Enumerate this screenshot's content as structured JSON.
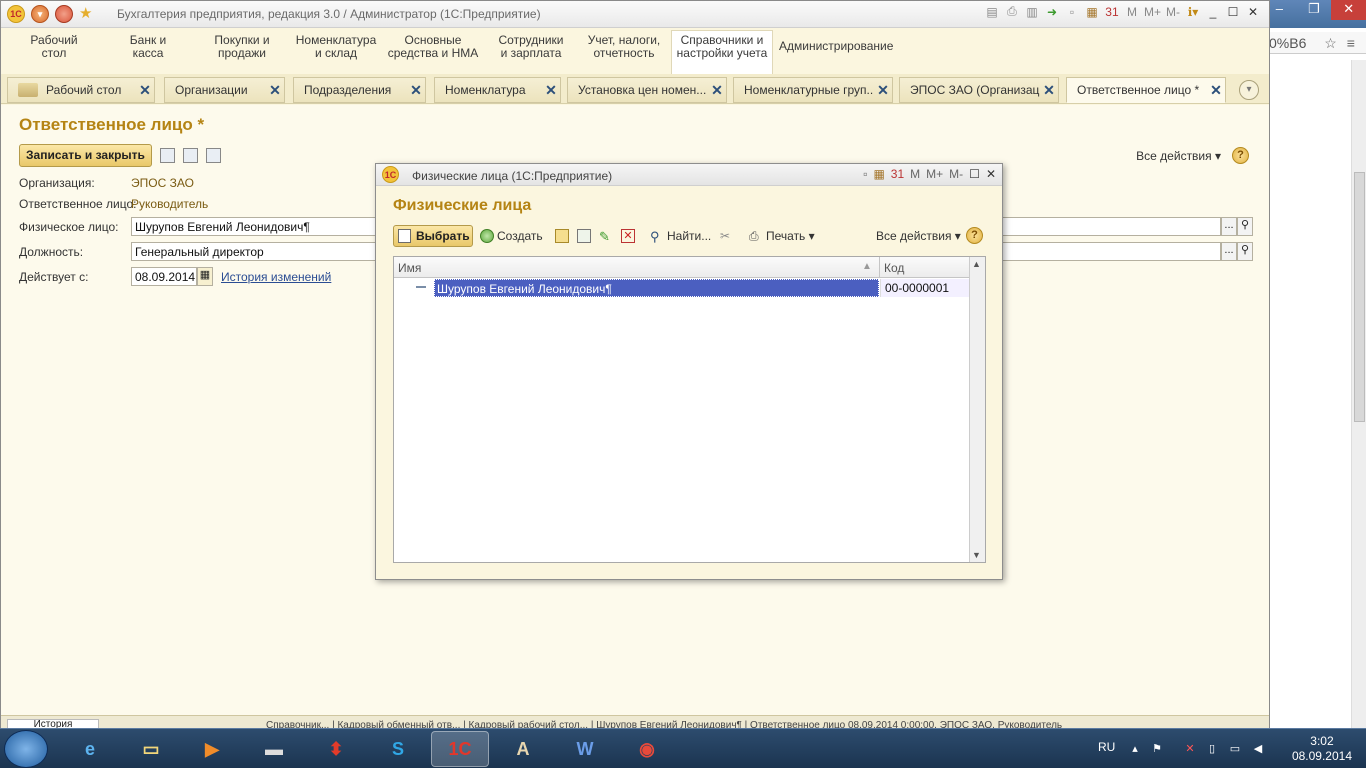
{
  "window": {
    "title": "Бухгалтерия предприятия, редакция 3.0 / Администратор  (1С:Предприятие)",
    "toolbar_labels": [
      "M",
      "M+",
      "M-"
    ]
  },
  "sections": [
    {
      "label1": "Рабочий",
      "label2": "стол"
    },
    {
      "label1": "Банк и",
      "label2": "касса"
    },
    {
      "label1": "Покупки и",
      "label2": "продажи"
    },
    {
      "label1": "Номенклатура",
      "label2": "и склад"
    },
    {
      "label1": "Основные",
      "label2": "средства и НМА"
    },
    {
      "label1": "Сотрудники",
      "label2": "и зарплата"
    },
    {
      "label1": "Учет, налоги,",
      "label2": "отчетность"
    },
    {
      "label1": "Справочники и",
      "label2": "настройки учета"
    },
    {
      "label1": "Администрирование",
      "label2": ""
    }
  ],
  "tabs": [
    {
      "label": "Рабочий стол"
    },
    {
      "label": "Организации"
    },
    {
      "label": "Подразделения"
    },
    {
      "label": "Номенклатура"
    },
    {
      "label": "Установка цен номен..."
    },
    {
      "label": "Номенклатурные груп..."
    },
    {
      "label": "ЭПОС ЗАО (Организац..."
    },
    {
      "label": "Ответственное лицо *"
    }
  ],
  "form": {
    "title": "Ответственное лицо *",
    "save_close": "Записать и закрыть",
    "all_actions": "Все действия",
    "help": "?",
    "org_label": "Организация:",
    "org_value": "ЭПОС ЗАО",
    "resp_label": "Ответственное лицо:",
    "resp_value": "Руководитель",
    "person_label": "Физическое лицо:",
    "person_value": "Шурупов Евгений Леонидович¶",
    "position_label": "Должность:",
    "position_value": "Генеральный директор",
    "date_label": "Действует с:",
    "date_value": "08.09.2014",
    "history_link": "История изменений",
    "more_button": "..."
  },
  "dialog": {
    "window_title": "Физические лица  (1С:Предприятие)",
    "heading": "Физические лица",
    "select_btn": "Выбрать",
    "create_btn": "Создать",
    "find_btn": "Найти...",
    "print_btn": "Печать",
    "all_actions": "Все действия",
    "help": "?",
    "col_name": "Имя",
    "col_code": "Код",
    "rows": [
      {
        "name": "Шурупов Евгений Леонидович¶",
        "code": "00-0000001"
      }
    ]
  },
  "statusbar": {
    "history": "История",
    "items": "Справочник...  |  Кадровый обменный отв...  |  Кадровый рабочий стол...  |  Шурупов Евгений Леонидович¶  |  Ответственное лицо 08.09.2014 0:00:00, ЭПОС ЗАО, Руководитель"
  },
  "browser": {
    "address_fragment": "0%B6"
  },
  "taskbar": {
    "language": "RU",
    "time": "3:02",
    "date": "08.09.2014"
  }
}
